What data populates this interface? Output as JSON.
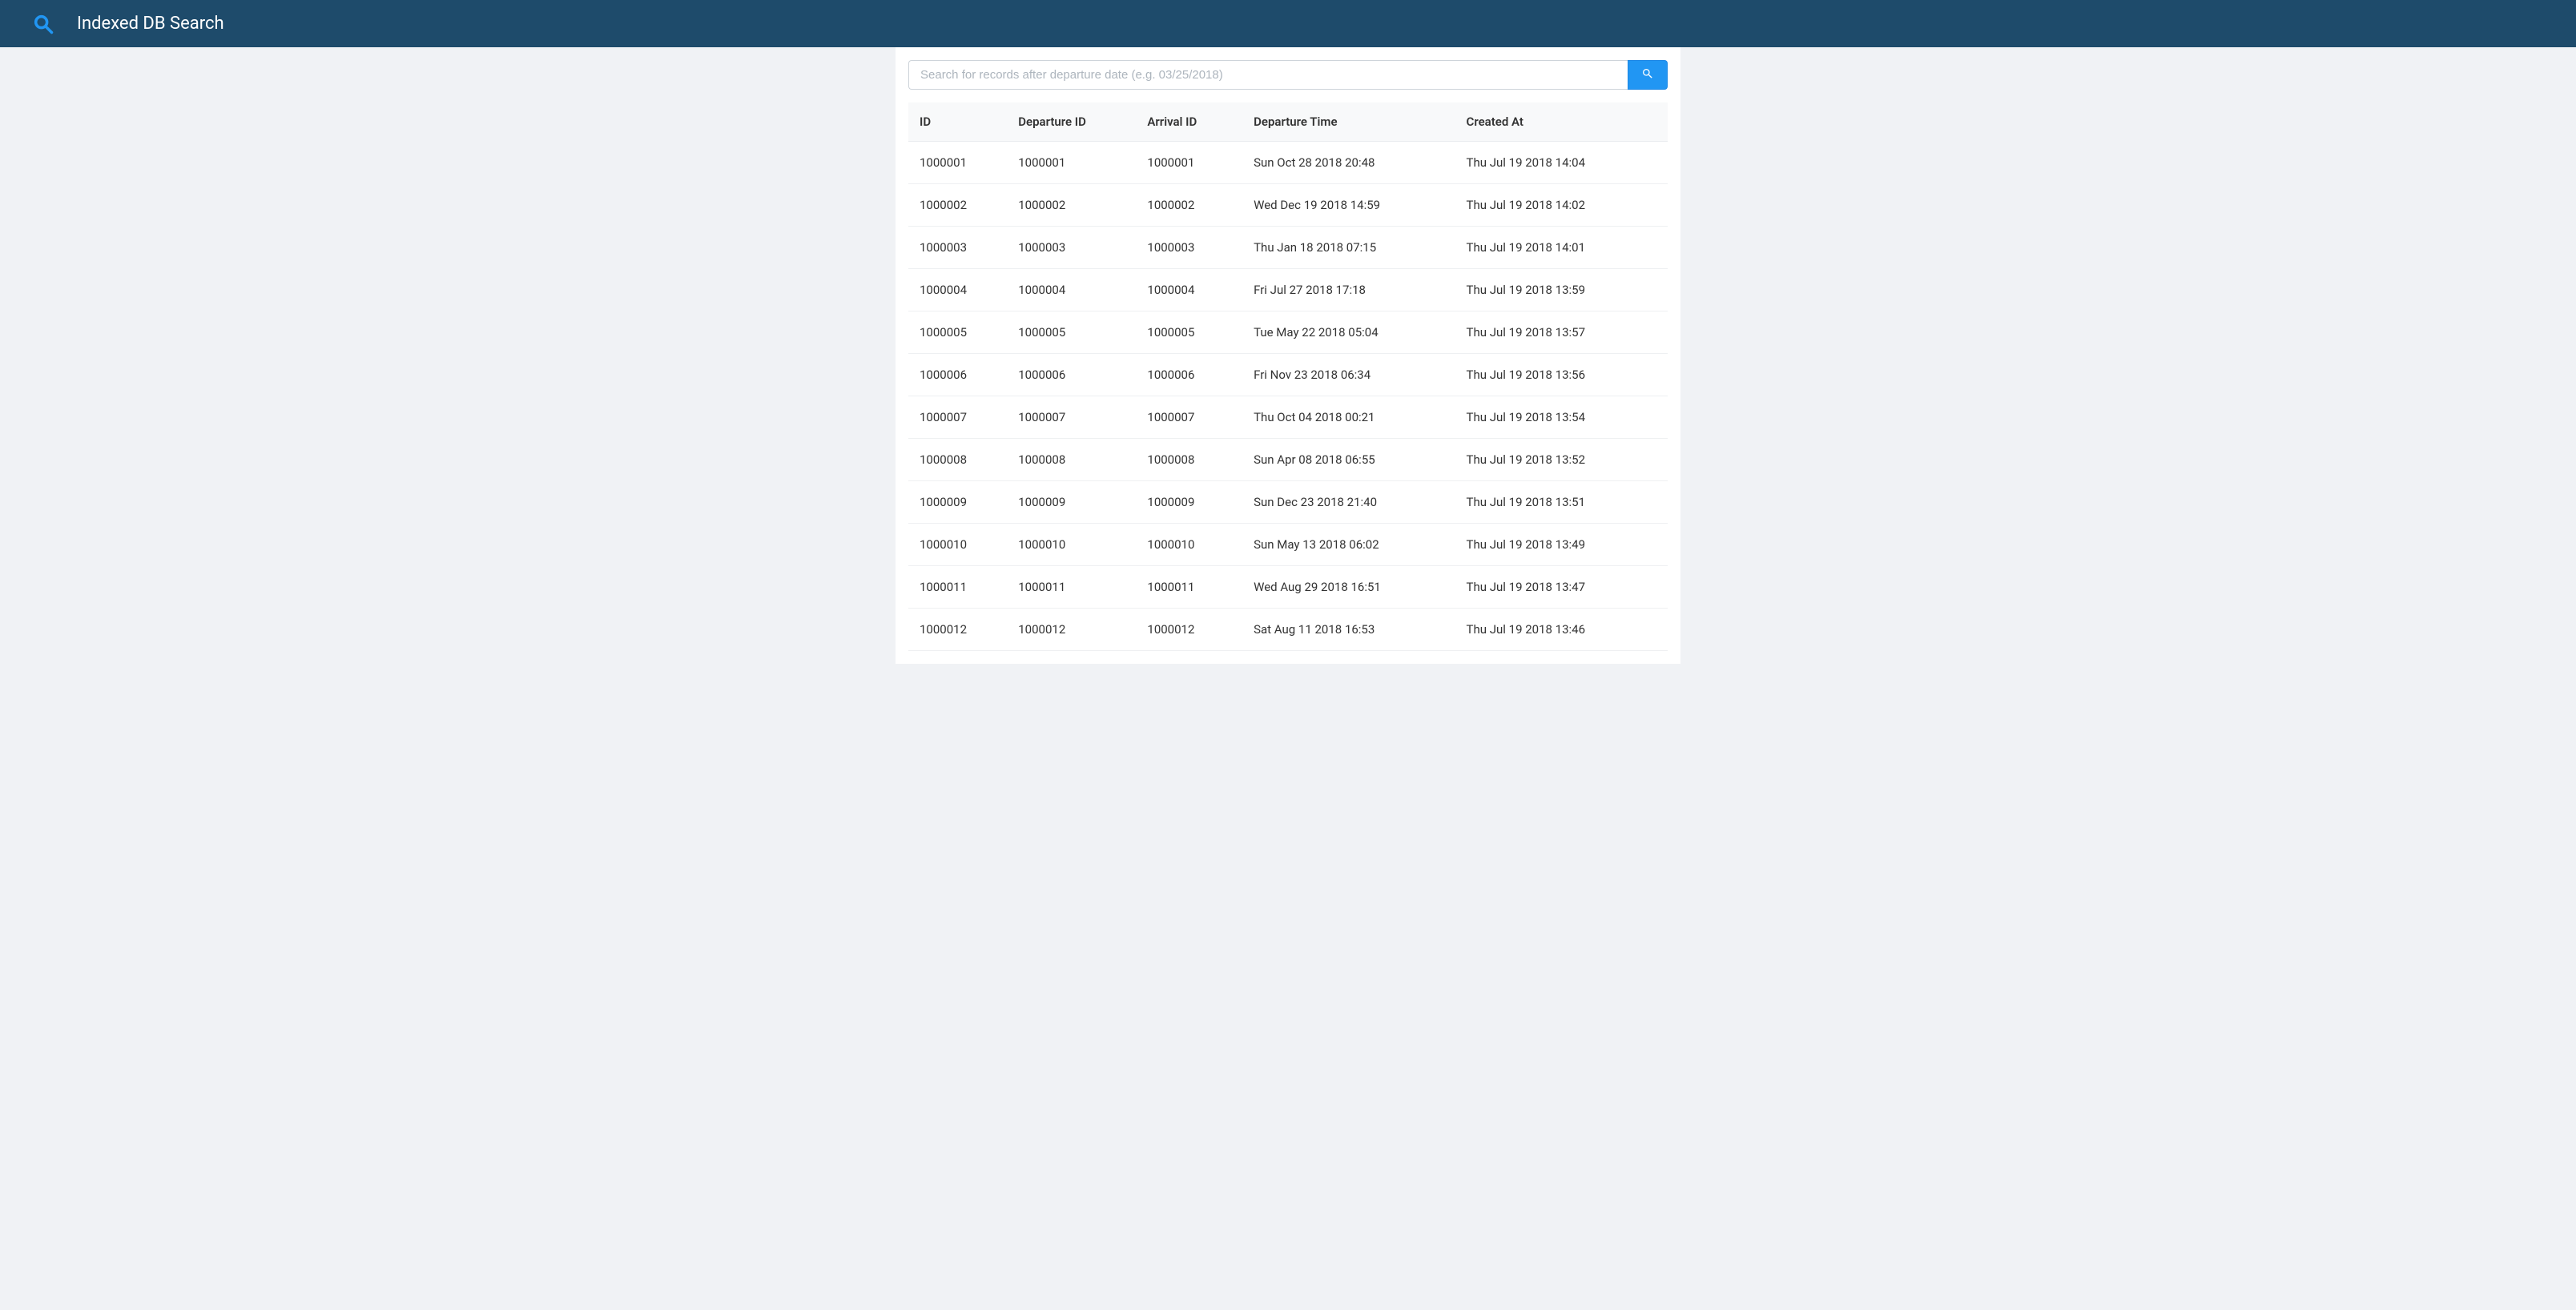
{
  "navbar": {
    "title": "Indexed DB Search"
  },
  "search": {
    "placeholder": "Search for records after departure date (e.g. 03/25/2018)",
    "value": ""
  },
  "table": {
    "headers": {
      "id": "ID",
      "departure_id": "Departure ID",
      "arrival_id": "Arrival ID",
      "departure_time": "Departure Time",
      "created_at": "Created At"
    },
    "rows": [
      {
        "id": "1000001",
        "departure_id": "1000001",
        "arrival_id": "1000001",
        "departure_time": "Sun Oct 28 2018 20:48",
        "created_at": "Thu Jul 19 2018 14:04"
      },
      {
        "id": "1000002",
        "departure_id": "1000002",
        "arrival_id": "1000002",
        "departure_time": "Wed Dec 19 2018 14:59",
        "created_at": "Thu Jul 19 2018 14:02"
      },
      {
        "id": "1000003",
        "departure_id": "1000003",
        "arrival_id": "1000003",
        "departure_time": "Thu Jan 18 2018 07:15",
        "created_at": "Thu Jul 19 2018 14:01"
      },
      {
        "id": "1000004",
        "departure_id": "1000004",
        "arrival_id": "1000004",
        "departure_time": "Fri Jul 27 2018 17:18",
        "created_at": "Thu Jul 19 2018 13:59"
      },
      {
        "id": "1000005",
        "departure_id": "1000005",
        "arrival_id": "1000005",
        "departure_time": "Tue May 22 2018 05:04",
        "created_at": "Thu Jul 19 2018 13:57"
      },
      {
        "id": "1000006",
        "departure_id": "1000006",
        "arrival_id": "1000006",
        "departure_time": "Fri Nov 23 2018 06:34",
        "created_at": "Thu Jul 19 2018 13:56"
      },
      {
        "id": "1000007",
        "departure_id": "1000007",
        "arrival_id": "1000007",
        "departure_time": "Thu Oct 04 2018 00:21",
        "created_at": "Thu Jul 19 2018 13:54"
      },
      {
        "id": "1000008",
        "departure_id": "1000008",
        "arrival_id": "1000008",
        "departure_time": "Sun Apr 08 2018 06:55",
        "created_at": "Thu Jul 19 2018 13:52"
      },
      {
        "id": "1000009",
        "departure_id": "1000009",
        "arrival_id": "1000009",
        "departure_time": "Sun Dec 23 2018 21:40",
        "created_at": "Thu Jul 19 2018 13:51"
      },
      {
        "id": "1000010",
        "departure_id": "1000010",
        "arrival_id": "1000010",
        "departure_time": "Sun May 13 2018 06:02",
        "created_at": "Thu Jul 19 2018 13:49"
      },
      {
        "id": "1000011",
        "departure_id": "1000011",
        "arrival_id": "1000011",
        "departure_time": "Wed Aug 29 2018 16:51",
        "created_at": "Thu Jul 19 2018 13:47"
      },
      {
        "id": "1000012",
        "departure_id": "1000012",
        "arrival_id": "1000012",
        "departure_time": "Sat Aug 11 2018 16:53",
        "created_at": "Thu Jul 19 2018 13:46"
      }
    ]
  }
}
